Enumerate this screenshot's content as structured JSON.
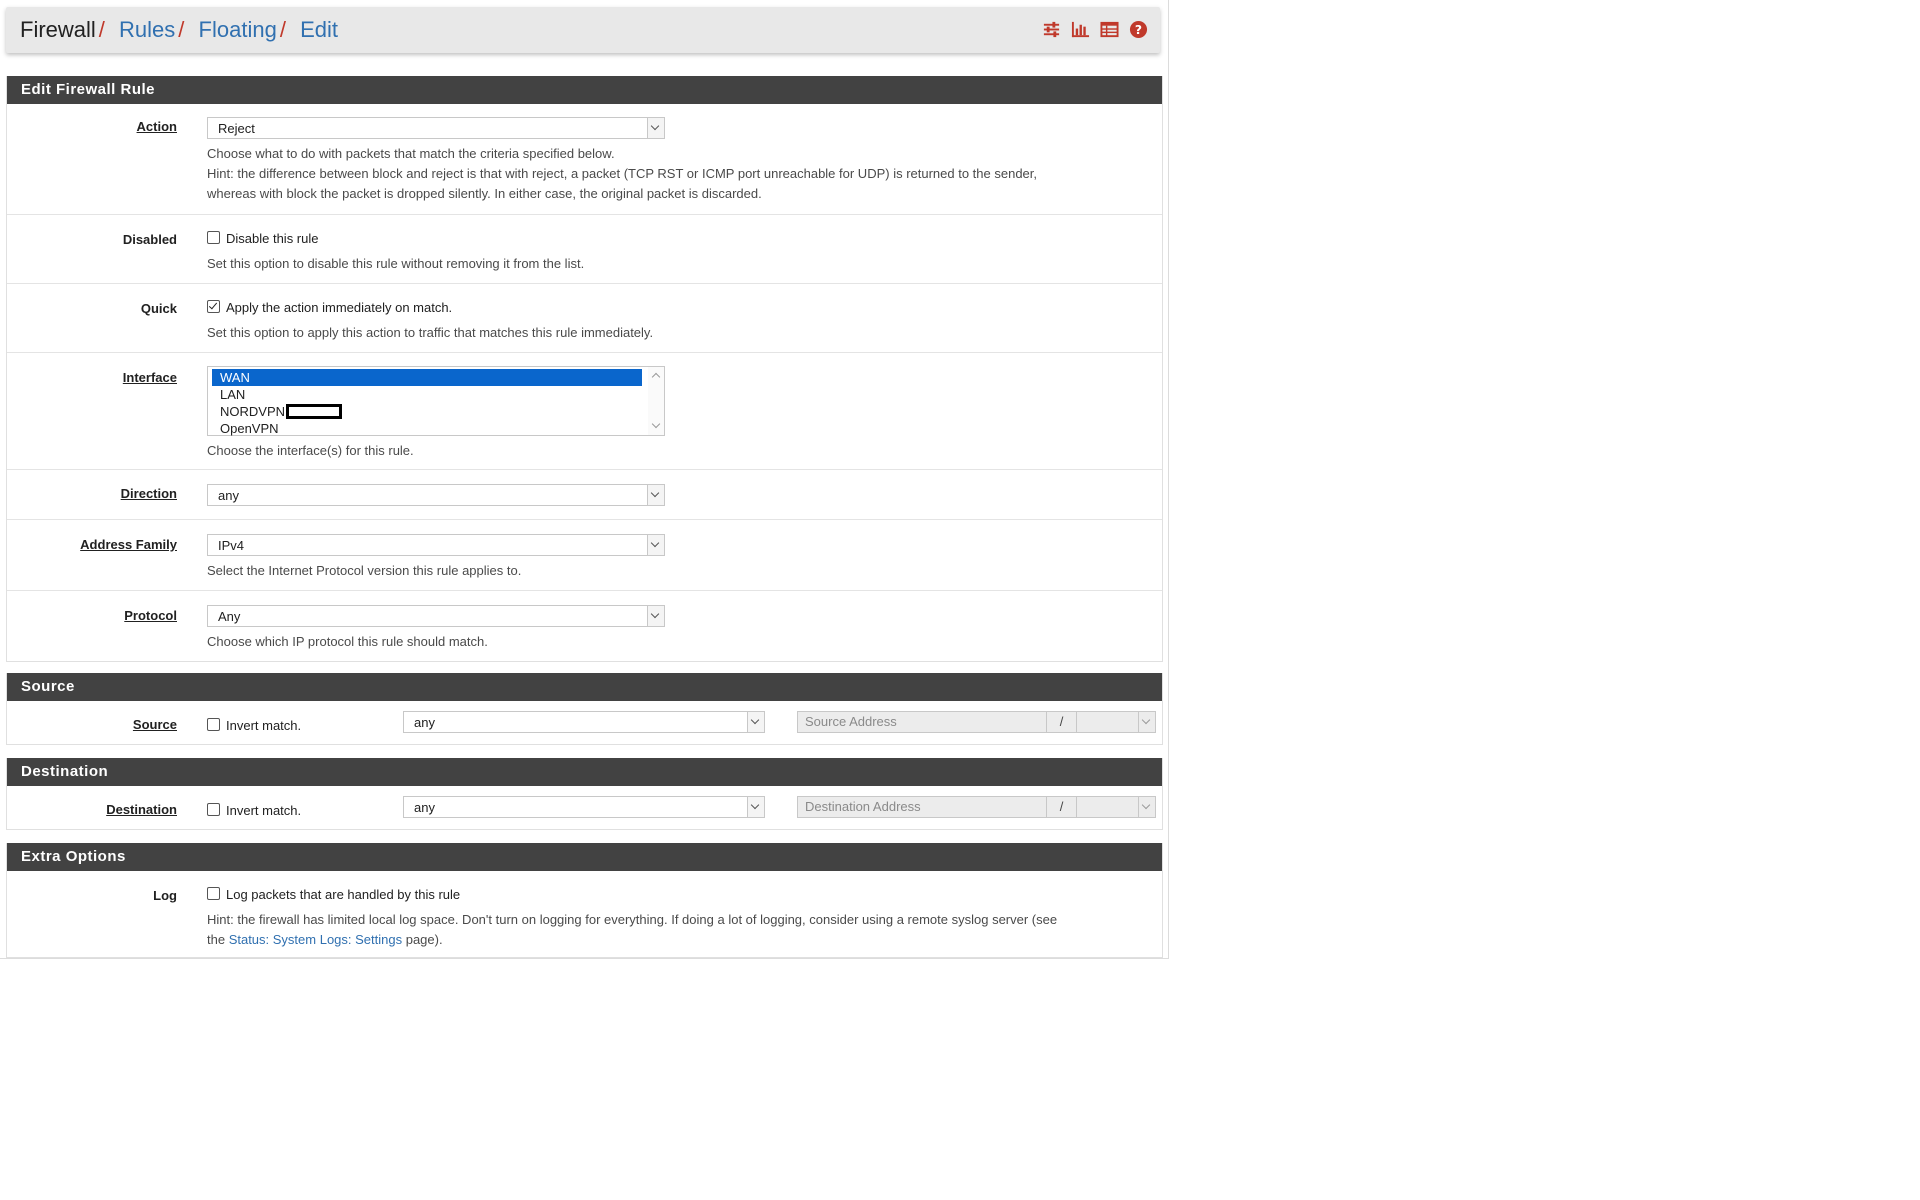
{
  "breadcrumb": {
    "items": [
      "Firewall",
      "Rules",
      "Floating",
      "Edit"
    ],
    "separator": "/"
  },
  "header_icons": [
    "sliders-icon",
    "bar-chart-icon",
    "table-icon",
    "help-icon"
  ],
  "colors": {
    "panel_header_bg": "#424242",
    "link": "#3070b0",
    "icon_red": "#c0392b",
    "selected_option": "#0a66cc"
  },
  "edit_panel": {
    "title": "Edit Firewall Rule",
    "action": {
      "label": "Action",
      "value": "Reject",
      "hint_1": "Choose what to do with packets that match the criteria specified below.",
      "hint_2": "Hint: the difference between block and reject is that with reject, a packet (TCP RST or ICMP port unreachable for UDP) is returned to the sender,",
      "hint_3": "whereas with block the packet is dropped silently. In either case, the original packet is discarded."
    },
    "disabled": {
      "label": "Disabled",
      "checkbox_label": "Disable this rule",
      "checked": false,
      "hint": "Set this option to disable this rule without removing it from the list."
    },
    "quick": {
      "label": "Quick",
      "checkbox_label": "Apply the action immediately on match.",
      "checked": true,
      "hint": "Set this option to apply this action to traffic that matches this rule immediately."
    },
    "interface": {
      "label": "Interface",
      "options": [
        "WAN",
        "LAN",
        "NORDVPN",
        "OpenVPN"
      ],
      "selected": "WAN",
      "hint": "Choose the interface(s) for this rule."
    },
    "direction": {
      "label": "Direction",
      "value": "any"
    },
    "address_family": {
      "label": "Address Family",
      "value": "IPv4",
      "hint": "Select the Internet Protocol version this rule applies to."
    },
    "protocol": {
      "label": "Protocol",
      "value": "Any",
      "hint": "Choose which IP protocol this rule should match."
    }
  },
  "source_panel": {
    "title": "Source",
    "label": "Source",
    "invert_label": "Invert match.",
    "type_value": "any",
    "address_placeholder": "Source Address",
    "slash": "/"
  },
  "destination_panel": {
    "title": "Destination",
    "label": "Destination",
    "invert_label": "Invert match.",
    "type_value": "any",
    "address_placeholder": "Destination Address",
    "slash": "/"
  },
  "extra_panel": {
    "title": "Extra Options",
    "log": {
      "label": "Log",
      "checkbox_label": "Log packets that are handled by this rule",
      "checked": false,
      "hint_1": "Hint: the firewall has limited local log space. Don't turn on logging for everything. If doing a lot of logging, consider using a remote syslog server (see",
      "hint_2_pre": "the ",
      "hint_2_link": "Status: System Logs: Settings",
      "hint_2_post": " page)."
    }
  }
}
